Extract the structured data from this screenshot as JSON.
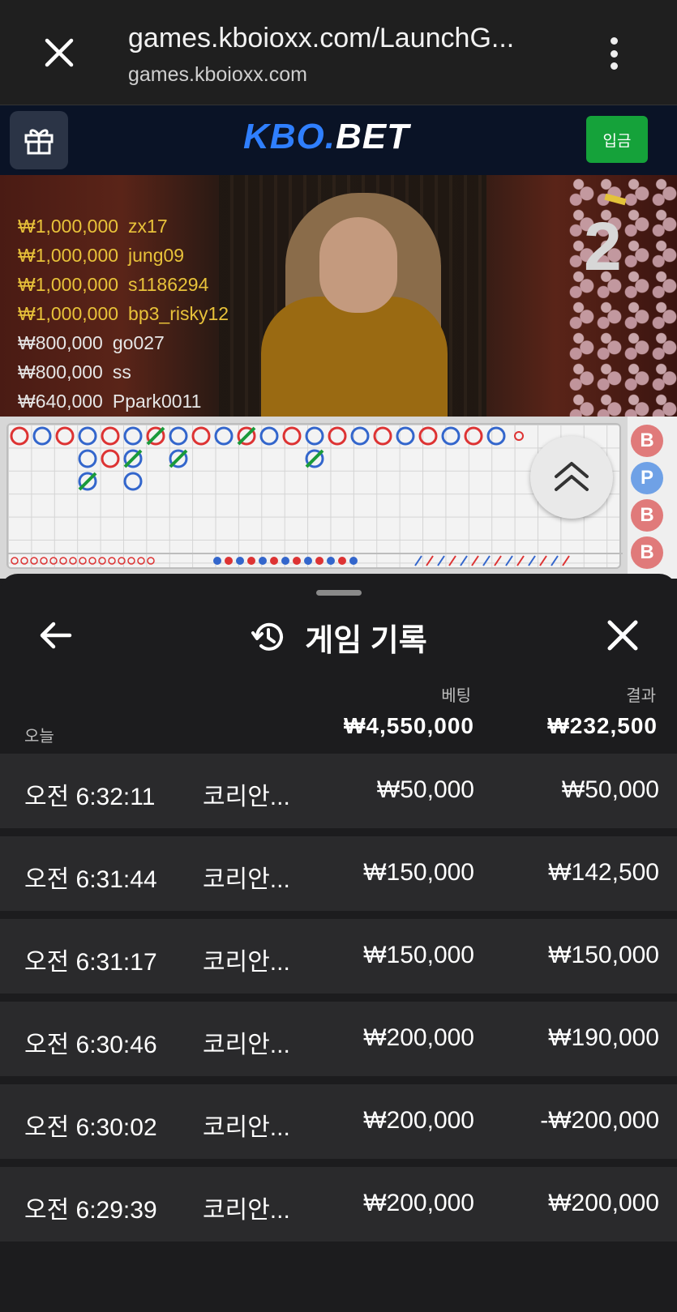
{
  "browser": {
    "url_main": "games.kboioxx.com/LaunchG...",
    "url_sub": "games.kboioxx.com",
    "close_icon": "close-icon",
    "menu_icon": "more-vert-icon"
  },
  "site": {
    "logo_part1": "KBO.",
    "logo_part2": "BET",
    "deposit_label": "입금",
    "gift_icon": "gift-icon",
    "colors": {
      "header_bg": "#0a1326",
      "deposit_green": "#15a23a",
      "logo_blue": "#2f7fff"
    }
  },
  "video": {
    "round_number": "2",
    "winners": [
      {
        "amount": "₩1,000,000",
        "name": "zx17",
        "tier": "gold"
      },
      {
        "amount": "₩1,000,000",
        "name": "jung09",
        "tier": "gold"
      },
      {
        "amount": "₩1,000,000",
        "name": "s1186294",
        "tier": "gold"
      },
      {
        "amount": "₩1,000,000",
        "name": "bp3_risky12",
        "tier": "gold"
      },
      {
        "amount": "₩800,000",
        "name": "go027",
        "tier": "silver"
      },
      {
        "amount": "₩800,000",
        "name": "ss",
        "tier": "silver"
      },
      {
        "amount": "₩640,000",
        "name": "Ppark0011",
        "tier": "silver"
      }
    ]
  },
  "scoreboard": {
    "beads": [
      "B",
      "P",
      "B",
      "B"
    ],
    "scroll_icon": "chevron-double-up-icon",
    "colors": {
      "banker": "#e07a7a",
      "player": "#6fa1e6"
    }
  },
  "history_sheet": {
    "title": "게임 기록",
    "title_icon": "history-icon",
    "back_icon": "arrow-left-icon",
    "close_icon": "close-icon",
    "column_bet": "베팅",
    "column_result": "결과",
    "today_label": "오늘",
    "total_bet": "₩4,550,000",
    "total_result": "₩232,500",
    "rows": [
      {
        "time": "오전 6:32:11",
        "game": "코리안...",
        "bet": "₩50,000",
        "result": "₩50,000"
      },
      {
        "time": "오전 6:31:44",
        "game": "코리안...",
        "bet": "₩150,000",
        "result": "₩142,500"
      },
      {
        "time": "오전 6:31:17",
        "game": "코리안...",
        "bet": "₩150,000",
        "result": "₩150,000"
      },
      {
        "time": "오전 6:30:46",
        "game": "코리안...",
        "bet": "₩200,000",
        "result": "₩190,000"
      },
      {
        "time": "오전 6:30:02",
        "game": "코리안...",
        "bet": "₩200,000",
        "result": "-₩200,000"
      },
      {
        "time": "오전 6:29:39",
        "game": "코리안...",
        "bet": "₩200,000",
        "result": "₩200,000"
      }
    ]
  }
}
